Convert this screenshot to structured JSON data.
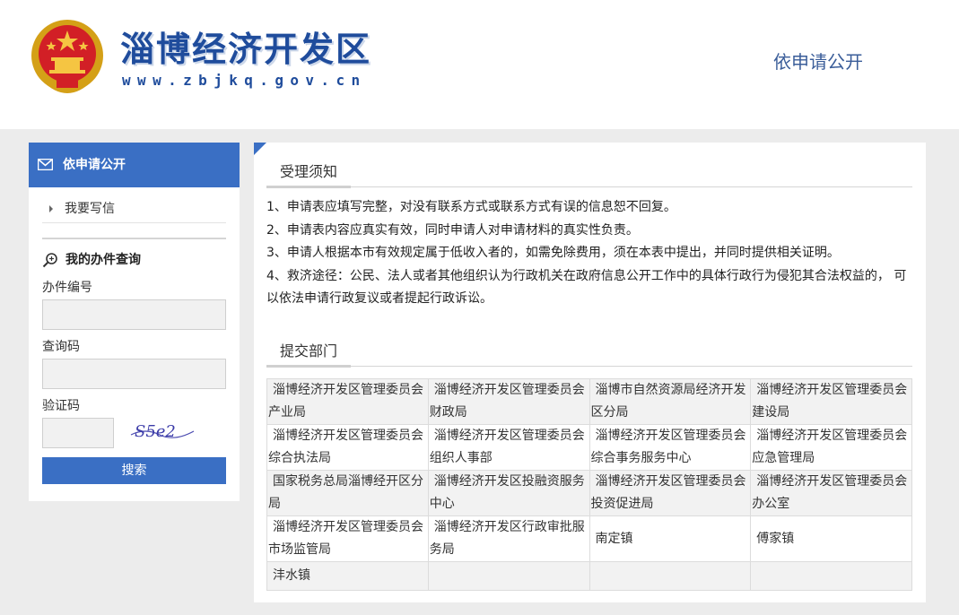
{
  "header": {
    "site_title": "淄博经济开发区",
    "site_url": "www.zbjkq.gov.cn",
    "nav_link": "依申请公开"
  },
  "sidebar": {
    "heading": "依申请公开",
    "menu": [
      {
        "label": "我要写信"
      }
    ],
    "query": {
      "title": "我的办件查询",
      "fields": {
        "case_number_label": "办件编号",
        "query_code_label": "查询码",
        "captcha_label": "验证码"
      },
      "captcha_text": "S5e2",
      "search_label": "搜索"
    }
  },
  "notice": {
    "title": "受理须知",
    "items": [
      "1、申请表应填写完整，对没有联系方式或联系方式有误的信息恕不回复。",
      "2、申请表内容应真实有效，同时申请人对申请材料的真实性负责。",
      "3、申请人根据本市有效规定属于低收入者的，如需免除费用，须在本表中提出，并同时提供相关证明。",
      "4、救济途径：公民、法人或者其他组织认为行政机关在政府信息公开工作中的具体行政行为侵犯其合法权益的， 可以依法申请行政复议或者提起行政诉讼。"
    ]
  },
  "departments": {
    "title": "提交部门",
    "rows": [
      [
        "淄博经济开发区管理委员会产业局",
        "淄博经济开发区管理委员会财政局",
        "淄博市自然资源局经济开发区分局",
        "淄博经济开发区管理委员会建设局"
      ],
      [
        "淄博经济开发区管理委员会综合执法局",
        "淄博经济开发区管理委员会组织人事部",
        "淄博经济开发区管理委员会综合事务服务中心",
        "淄博经济开发区管理委员会应急管理局"
      ],
      [
        "国家税务总局淄博经开区分局",
        "淄博经济开发区投融资服务中心",
        "淄博经济开发区管理委员会投资促进局",
        "淄博经济开发区管理委员会办公室"
      ],
      [
        "淄博经济开发区管理委员会市场监管局",
        "淄博经济开发区行政审批服务局",
        "南定镇",
        "傅家镇"
      ],
      [
        "沣水镇",
        "",
        "",
        ""
      ]
    ]
  },
  "colors": {
    "brand_blue": "#3a6fc4",
    "title_blue": "#1f4c9c",
    "page_grey": "#ececec"
  }
}
